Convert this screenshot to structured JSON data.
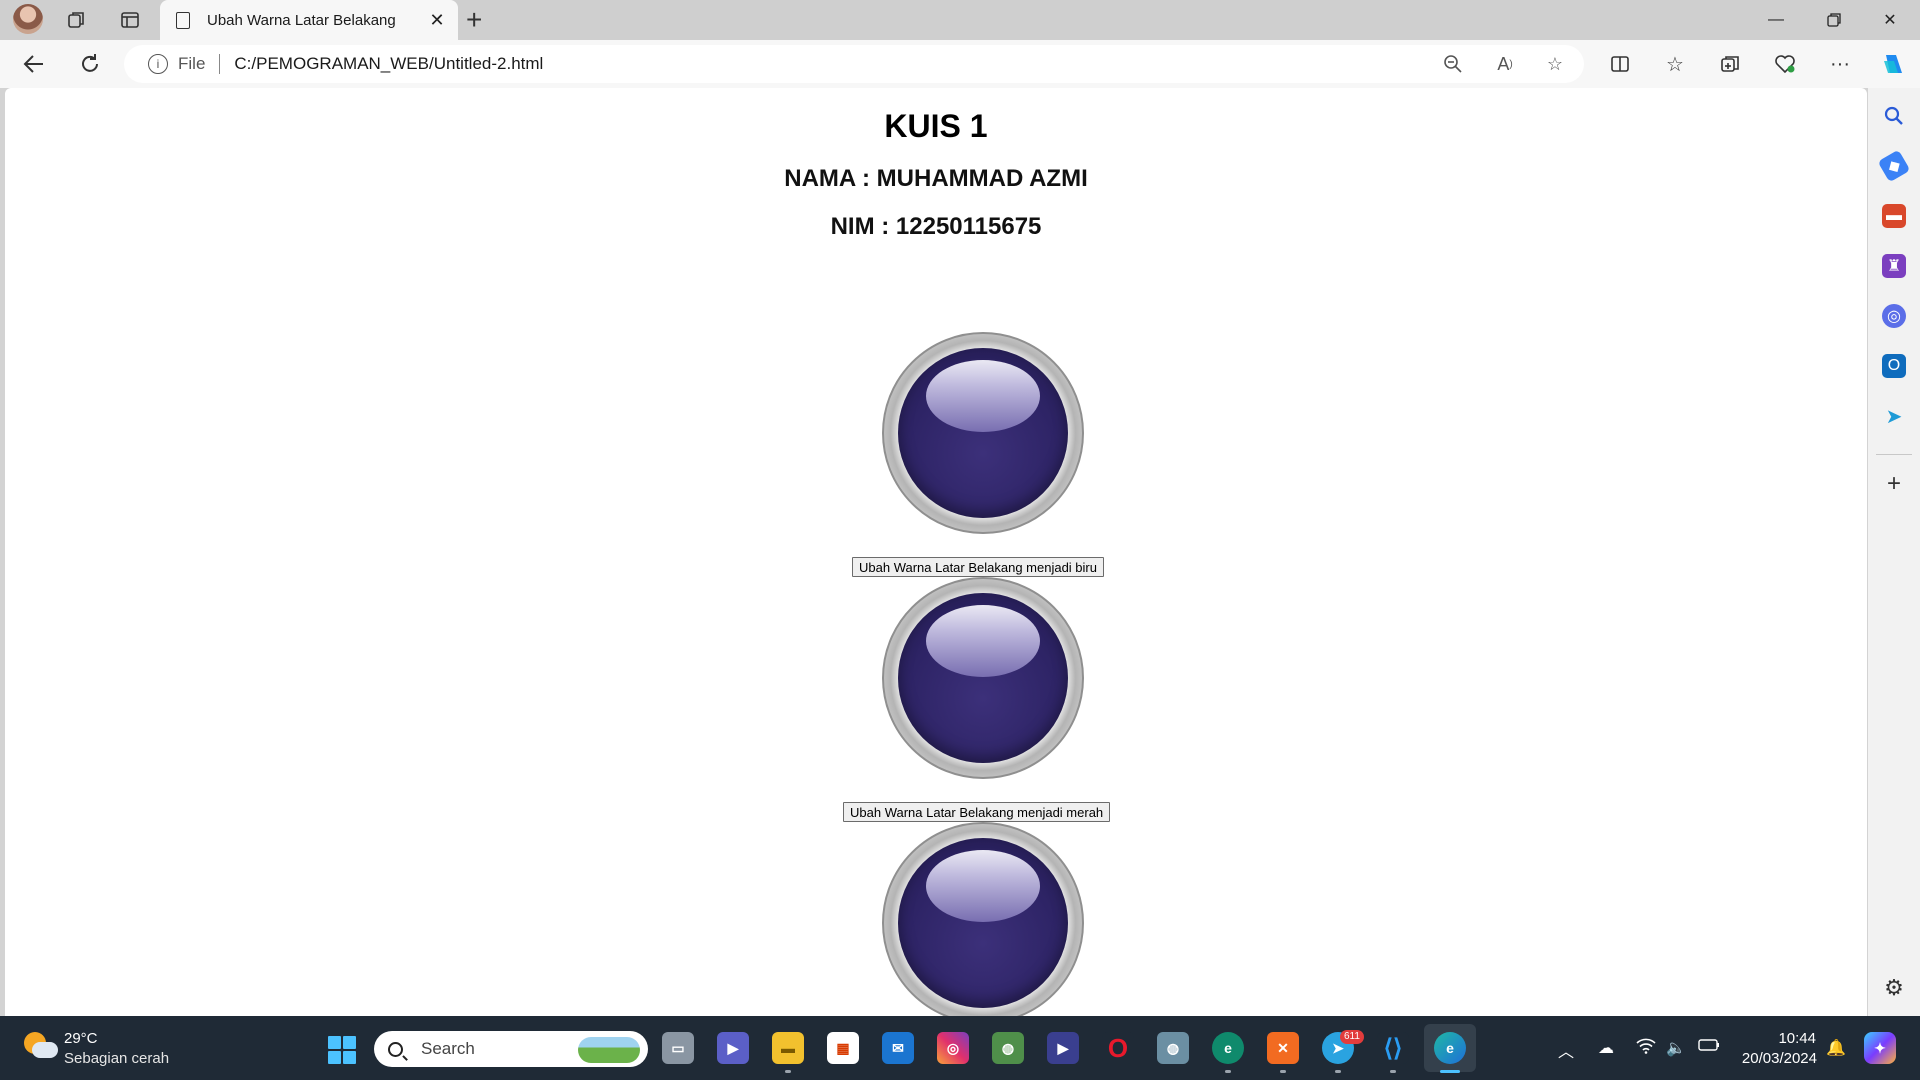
{
  "browser": {
    "tab_title": "Ubah Warna Latar Belakang",
    "url_scheme_label": "File",
    "url": "C:/PEMOGRAMAN_WEB/Untitled-2.html"
  },
  "page": {
    "title": "KUIS 1",
    "name_line": "NAMA : MUHAMMAD AZMI",
    "nim_line": "NIM : 12250115675",
    "button_blue": "Ubah Warna Latar Belakang menjadi biru",
    "button_red": "Ubah Warna Latar Belakang menjadi merah",
    "ball_color": "#2e2466"
  },
  "taskbar": {
    "temperature": "29°C",
    "weather_condition": "Sebagian cerah",
    "search_placeholder": "Search",
    "telegram_badge": "611",
    "time": "10:44",
    "date": "20/03/2024"
  },
  "colors": {
    "accent": "#4cc2ff",
    "taskbar_bg": "#1f2a36"
  }
}
